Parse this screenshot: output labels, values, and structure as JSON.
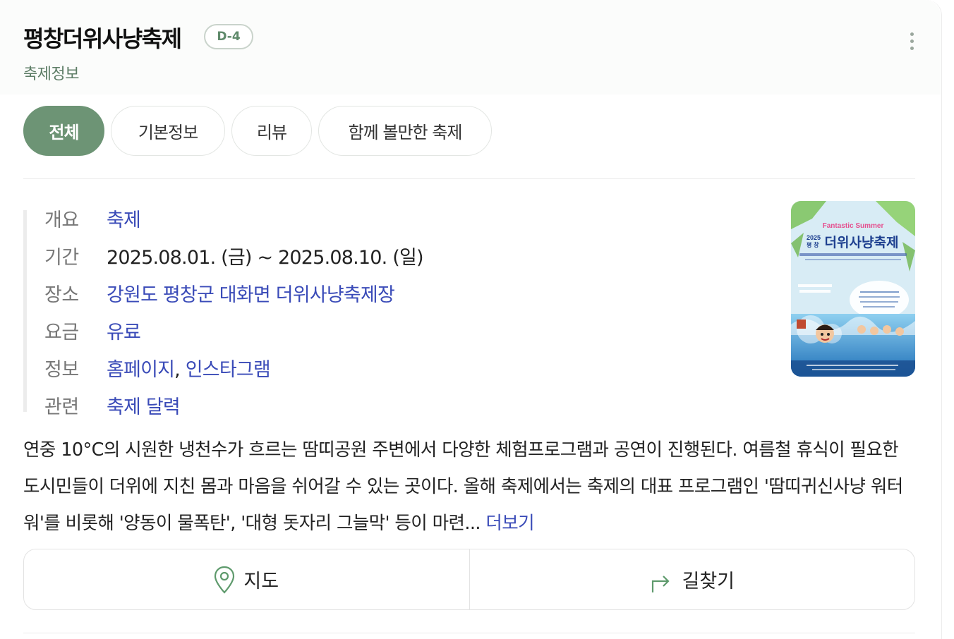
{
  "header": {
    "title": "평창더위사냥축제",
    "dday_badge": "D-4",
    "subtitle": "축제정보",
    "more_icon": "vertical-ellipsis"
  },
  "tabs": [
    {
      "label": "전체",
      "active": true
    },
    {
      "label": "기본정보",
      "active": false
    },
    {
      "label": "리뷰",
      "active": false
    },
    {
      "label": "함께 볼만한 축제",
      "active": false
    }
  ],
  "info": {
    "overview": {
      "key": "개요",
      "value": "축제"
    },
    "period": {
      "key": "기간",
      "value": "2025.08.01. (금) ~  2025.08.10. (일)"
    },
    "place": {
      "key": "장소",
      "value": "강원도 평창군 대화면 더위사냥축제장"
    },
    "fee": {
      "key": "요금",
      "value": "유료"
    },
    "links": {
      "key": "정보",
      "homepage": "홈페이지",
      "separator": ",",
      "instagram": "인스타그램"
    },
    "related": {
      "key": "관련",
      "value": "축제 달력"
    }
  },
  "poster": {
    "headline": "Fantastic Summer",
    "year": "2025",
    "place": "평 창",
    "title": "더위사냥축제"
  },
  "description": {
    "text": "연중 10°C의 시원한 냉천수가 흐르는 땀띠공원 주변에서 다양한 체험프로그램과 공연이 진행된다. 여름철 휴식이 필요한 도시민들이 더위에 지친 몸과 마음을 쉬어갈 수 있는 곳이다. 올해 축제에서는 축제의 대표 프로그램인 '땀띠귀신사냥 워터워'를 비롯해 '양동이 물폭탄', '대형 돗자리 그늘막' 등이 마련...",
    "more_label": "더보기"
  },
  "actions": [
    {
      "label": "지도",
      "icon": "map-pin-icon"
    },
    {
      "label": "길찾기",
      "icon": "directions-arrow-icon"
    }
  ],
  "colors": {
    "accent_green": "#6d9475",
    "link_blue": "#3a4bb8",
    "subtitle_green": "#5d7d66"
  }
}
